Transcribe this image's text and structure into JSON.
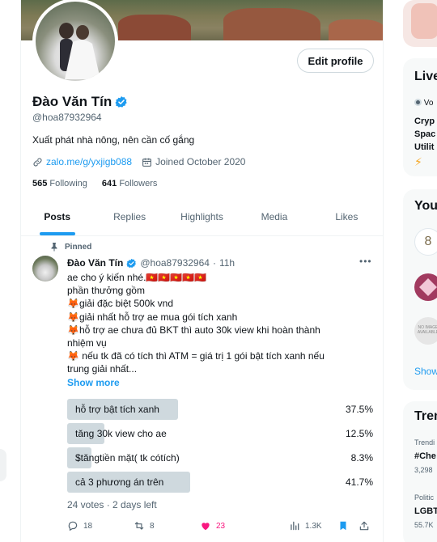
{
  "profile": {
    "name": "Đào Văn Tín",
    "handle": "@hoa87932964",
    "bio": "Xuất phát nhà nông, nên cần cố gắng",
    "link": "zalo.me/g/yxjigb088",
    "joined": "Joined October 2020",
    "following_count": "565",
    "following_label": "Following",
    "followers_count": "641",
    "followers_label": "Followers",
    "edit_button": "Edit profile"
  },
  "tabs": [
    "Posts",
    "Replies",
    "Highlights",
    "Media",
    "Likes"
  ],
  "tweet": {
    "pinned_label": "Pinned",
    "author": "Đào Văn Tín",
    "handle": "@hoa87932964",
    "sep": "·",
    "time": "11h",
    "lines": [
      "ae cho ý kiến nhé.🇻🇳🇻🇳🇻🇳🇻🇳🇻🇳",
      "phần thưởng gồm",
      "🦊giải đặc biệt 500k vnd",
      "🦊giải nhất  hỗ trợ ae mua gói tích xanh",
      "🦊hỗ trợ ae chưa đủ BKT  thì auto 30k view khi hoàn thành",
      "nhiệm vụ",
      "🦊 nếu tk đã có tích thì  ATM = giá trị 1 gói bật tích xanh nếu",
      "trung giải nhất..."
    ],
    "show_more": "Show more",
    "poll": [
      {
        "label": "hỗ trợ bật tích xanh",
        "percent": "37.5%",
        "value": 37.5
      },
      {
        "label": "tăng 30k view cho ae",
        "percent": "12.5%",
        "value": 12.5
      },
      {
        "label": "$tăngtiền mặt( tk cótích)",
        "percent": "8.3%",
        "value": 8.3
      },
      {
        "label": "cả 3 phương án trên",
        "percent": "41.7%",
        "value": 41.7
      }
    ],
    "poll_summary": "24 votes · 2 days left",
    "replies": "18",
    "retweets": "8",
    "likes": "23",
    "views": "1.3K"
  },
  "sidebar": {
    "live_heading": "Live",
    "live_tag": "Vo",
    "live_lines": [
      "Cryp",
      "Spac",
      "Utilit"
    ],
    "you_heading": "You",
    "no_image_text": "NO IMAGE AVAILABLE",
    "show_label": "Show",
    "trends_heading": "Tren",
    "trend1_cat": "Trendi",
    "trend1_name": "#Che",
    "trend1_count": "3,298",
    "trend2_cat": "Politic",
    "trend2_name": "LGBT",
    "trend2_count": "55.7K"
  },
  "colors": {
    "accent": "#1d9bf0",
    "like": "#f91880",
    "text": "#0f1419",
    "muted": "#536471",
    "poll_bar": "#cfd9de"
  }
}
